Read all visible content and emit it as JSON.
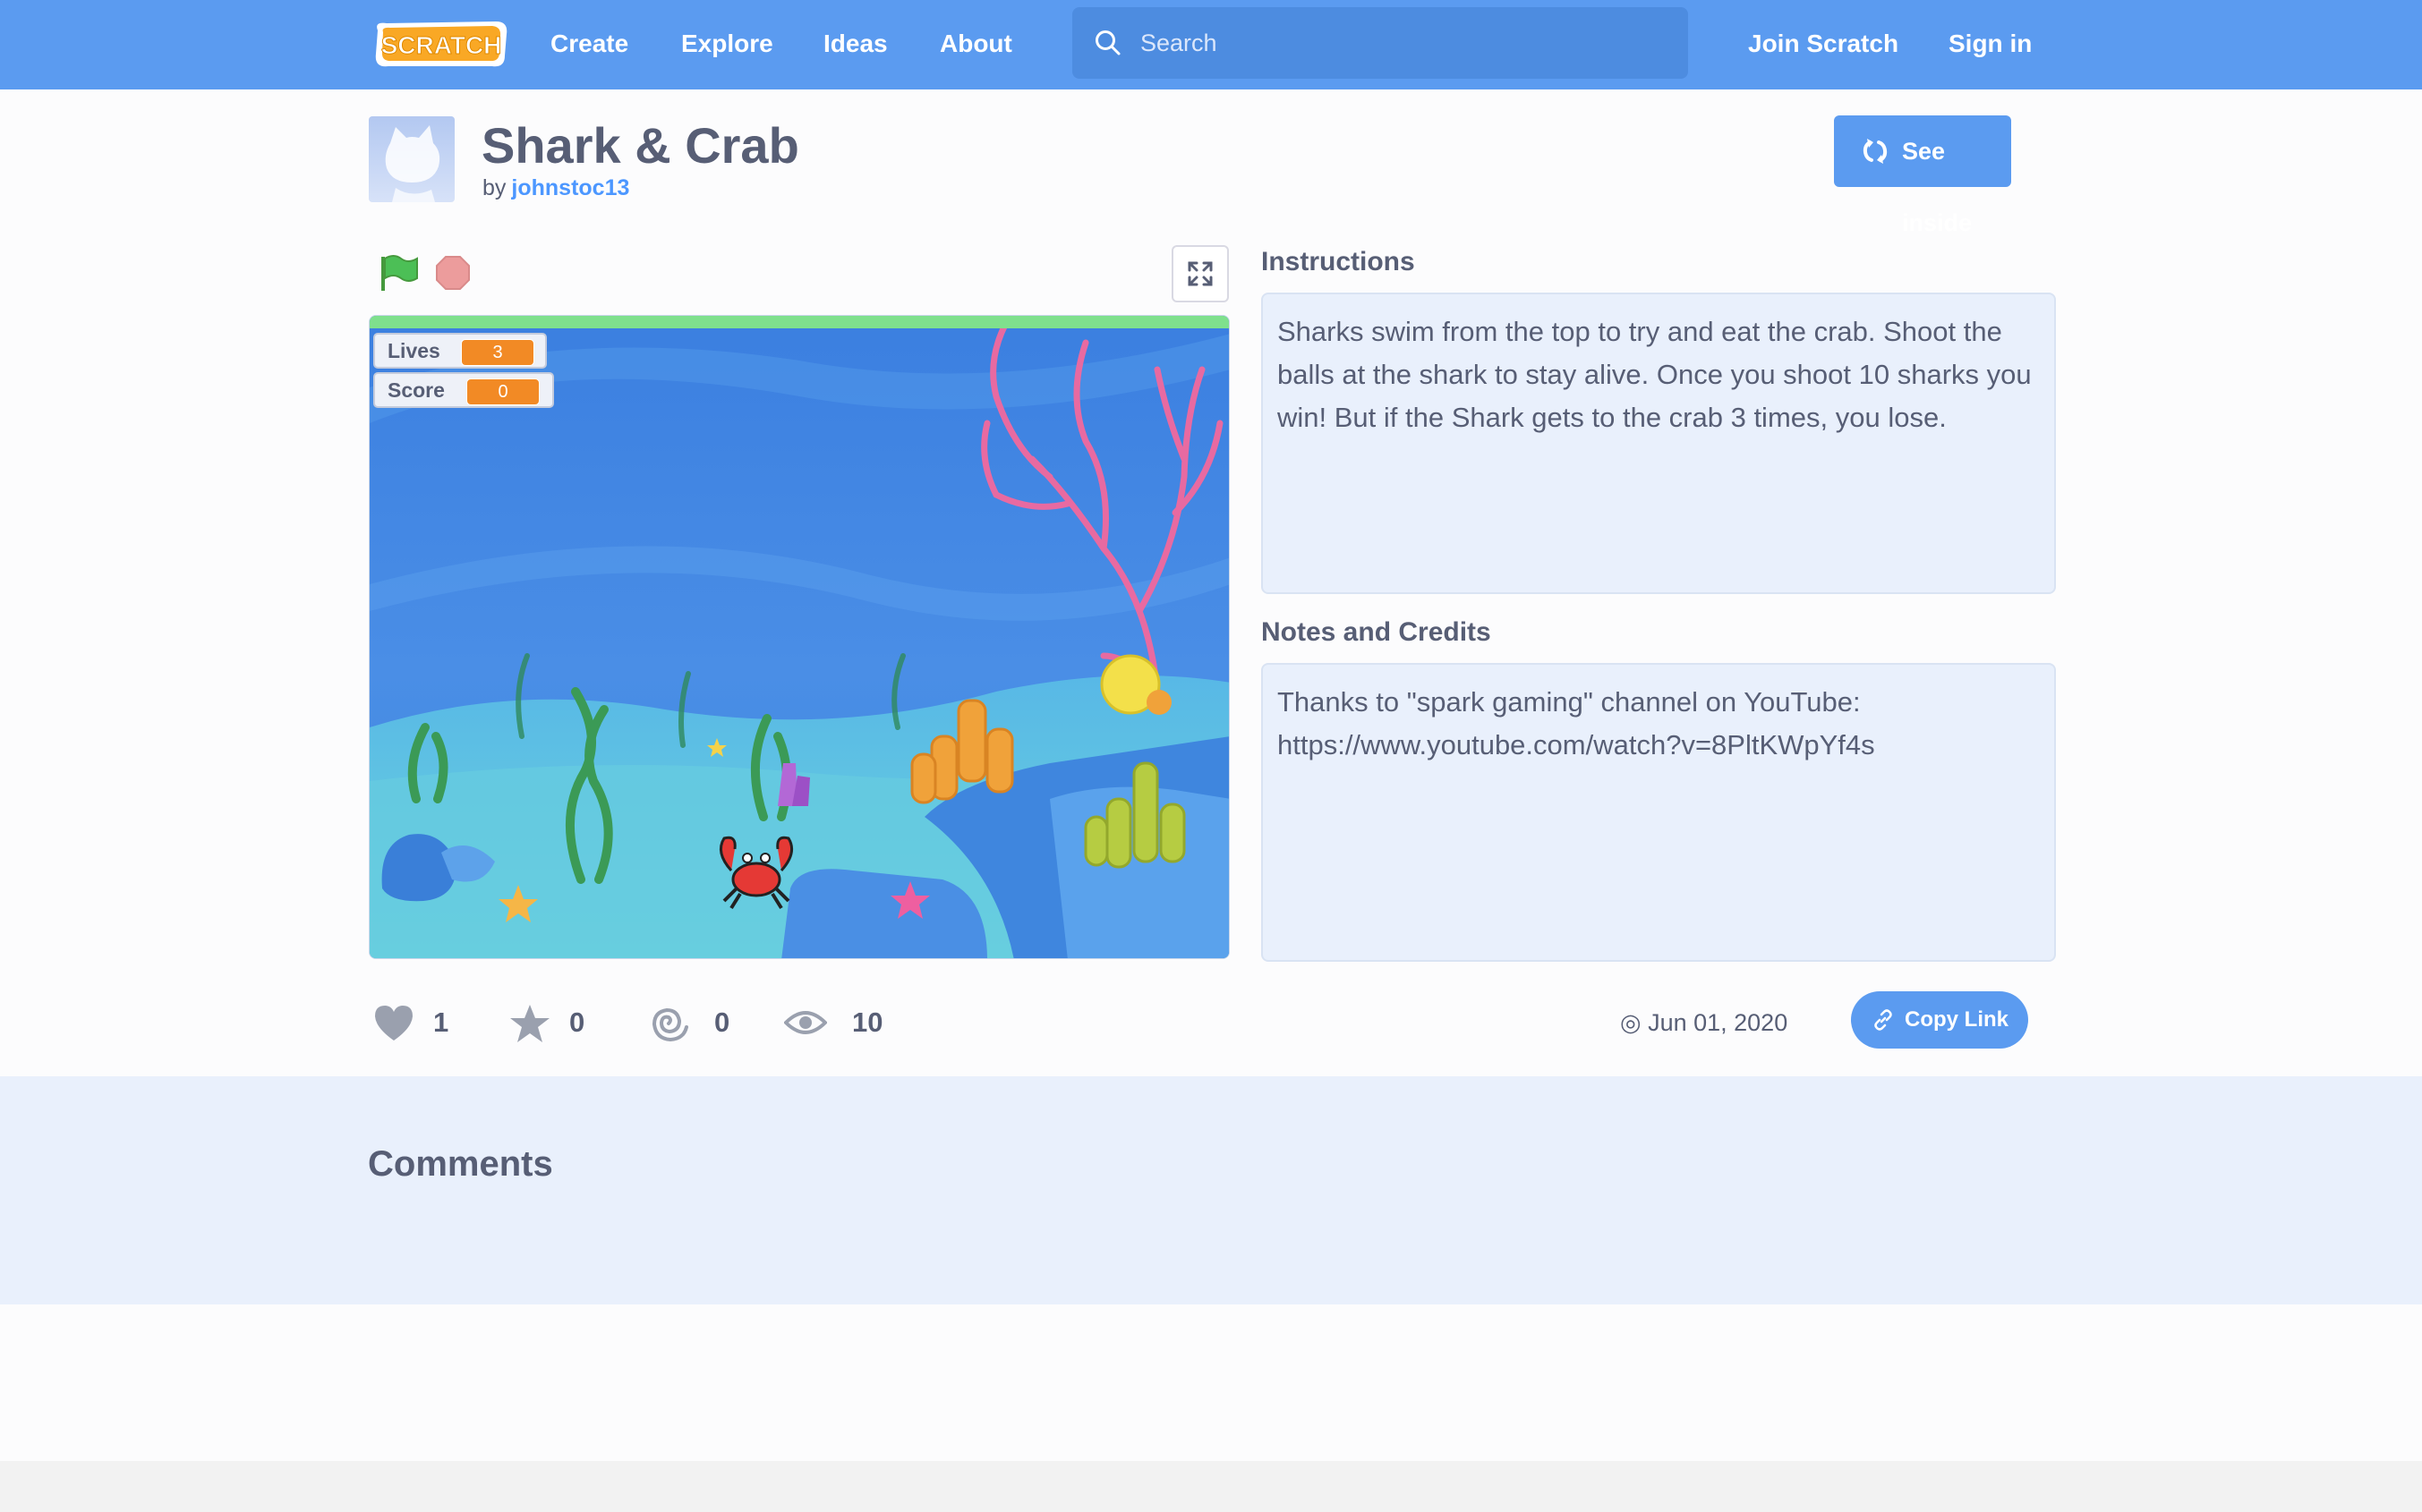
{
  "nav": {
    "logo_text": "SCRATCH",
    "links": [
      "Create",
      "Explore",
      "Ideas",
      "About"
    ],
    "search_placeholder": "Search",
    "join": "Join Scratch",
    "sign_in": "Sign in"
  },
  "project": {
    "title": "Shark & Crab",
    "by": "by",
    "author": "johnstoc13",
    "see_inside": "See inside",
    "monitors": {
      "lives_label": "Lives",
      "lives_value": "3",
      "score_label": "Score",
      "score_value": "0"
    },
    "instructions_heading": "Instructions",
    "instructions": "Sharks swim from the top to try and eat the crab. Shoot the balls at the shark to stay alive. Once you shoot 10 sharks you win! But if the Shark gets to the crab 3 times, you lose.",
    "notes_heading": "Notes and Credits",
    "notes": "Thanks to \"spark gaming\" channel on YouTube:\nhttps://www.youtube.com/watch?v=8PltKWpYf4s",
    "stats": {
      "loves": "1",
      "favorites": "0",
      "remixes": "0",
      "views": "10"
    },
    "date": "Jun 01, 2020",
    "copy_link": "Copy Link"
  },
  "comments": {
    "title": "Comments"
  },
  "colors": {
    "brand_blue": "#5b9bf0",
    "accent_orange": "#f28a25",
    "text": "#575e75"
  }
}
